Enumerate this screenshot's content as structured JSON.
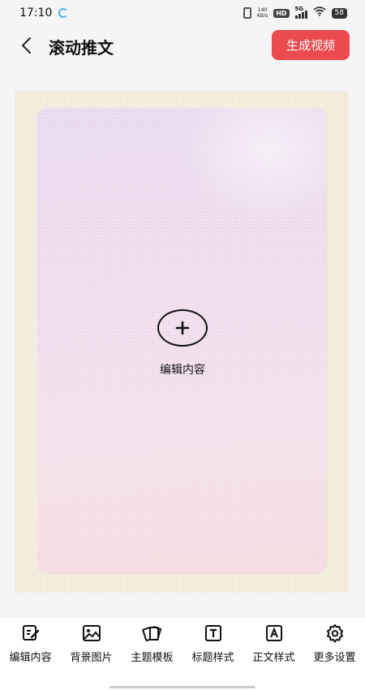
{
  "status_bar": {
    "time": "17:10",
    "speed_value": "140",
    "speed_unit": "KB/s",
    "hd": "HD",
    "network": "5G",
    "battery": "58"
  },
  "header": {
    "title": "滚动推文",
    "generate_label": "生成视频"
  },
  "preview": {
    "add_label": "编辑内容"
  },
  "toolbar": {
    "items": [
      {
        "label": "编辑内容",
        "icon": "edit-icon"
      },
      {
        "label": "背景图片",
        "icon": "image-icon"
      },
      {
        "label": "主题模板",
        "icon": "template-cards-icon"
      },
      {
        "label": "标题样式",
        "icon": "title-style-icon"
      },
      {
        "label": "正文样式",
        "icon": "text-style-icon"
      },
      {
        "label": "更多设置",
        "icon": "gear-icon"
      }
    ]
  },
  "colors": {
    "accent": "#eb4a4f",
    "frame": "#f6f1e3",
    "card": "#efdcec"
  }
}
